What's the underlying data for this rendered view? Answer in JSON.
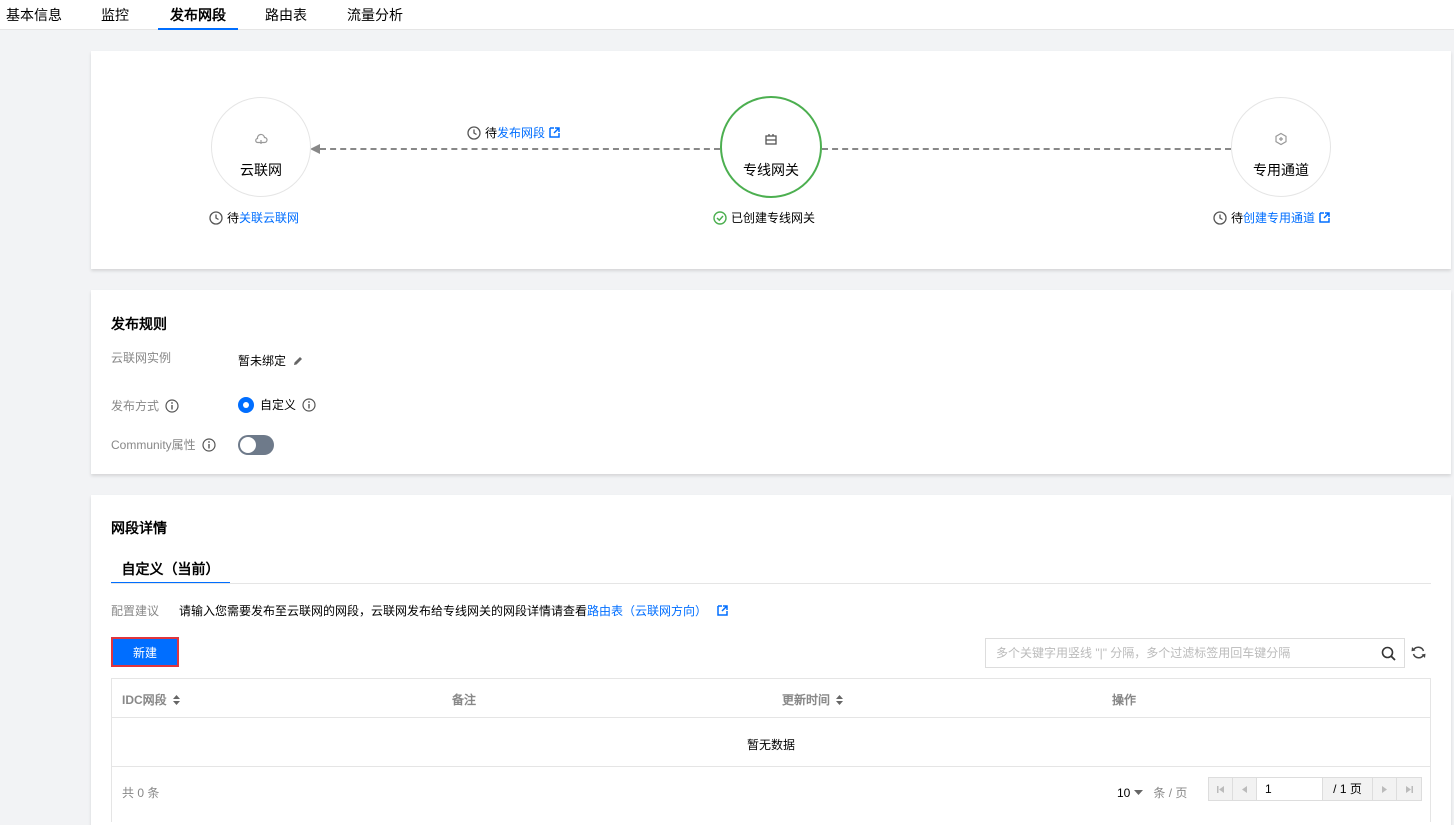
{
  "tabs": [
    {
      "label": "基本信息",
      "active": false
    },
    {
      "label": "监控",
      "active": false
    },
    {
      "label": "发布网段",
      "active": true
    },
    {
      "label": "路由表",
      "active": false
    },
    {
      "label": "流量分析",
      "active": false
    }
  ],
  "topology": {
    "ccn": {
      "label": "云联网",
      "status_prefix": "待",
      "status_link": "关联云联网",
      "icon": "cloud-icon"
    },
    "gateway": {
      "label": "专线网关",
      "status_text": "已创建专线网关",
      "icon": "gateway-icon"
    },
    "channel": {
      "label": "专用通道",
      "status_prefix": "待",
      "status_link": "创建专用通道",
      "icon": "channel-icon"
    },
    "publish_prefix": "待",
    "publish_link": "发布网段",
    "colors": {
      "active_border": "#4caf50",
      "link": "#006eff"
    }
  },
  "rules": {
    "title": "发布规则",
    "ccn_instance_label": "云联网实例",
    "ccn_instance_value": "暂未绑定",
    "publish_mode_label": "发布方式",
    "publish_mode_value": "自定义",
    "community_label": "Community属性",
    "community_enabled": false
  },
  "detail": {
    "title": "网段详情",
    "subtab": "自定义（当前）",
    "hint_label": "配置建议",
    "hint_text": "请输入您需要发布至云联网的网段，云联网发布给专线网关的网段详情请查看",
    "hint_link": "路由表（云联网方向）",
    "new_button": "新建",
    "search_placeholder": "多个关键字用竖线 \"|\" 分隔，多个过滤标签用回车键分隔",
    "search_value": "",
    "columns": [
      "IDC网段",
      "备注",
      "更新时间",
      "操作"
    ],
    "empty_text": "暂无数据",
    "total_text": "共 0 条",
    "page_size": "10",
    "page_size_unit": "条 / 页",
    "page_input": "1",
    "page_total": "/ 1 页"
  }
}
